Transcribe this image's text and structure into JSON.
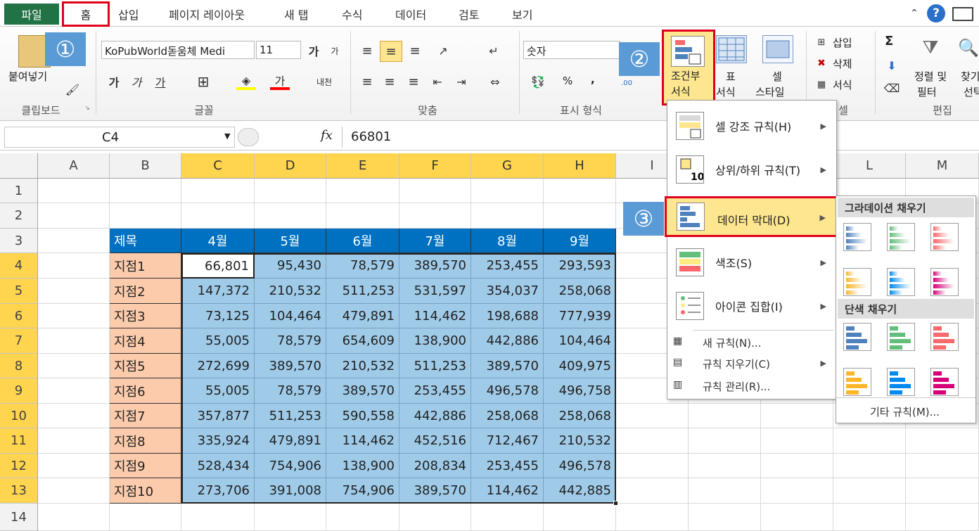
{
  "tabs": {
    "file": "파일",
    "home": "홈",
    "insert": "삽입",
    "layout": "페이지 레이아웃",
    "newtab": "새 탭",
    "formulas": "수식",
    "data": "데이터",
    "review": "검토",
    "view": "보기"
  },
  "ribbon": {
    "paste": "붙여넣기",
    "font_name": "KoPubWorld돋움체 Medi",
    "font_size": "11",
    "number_format": "숫자",
    "percent": "%",
    "comma": ",",
    "conditional_format_line1": "조건부",
    "conditional_format_line2": "서식",
    "table_format_line1": "표",
    "table_format_line2": "서식",
    "cell_style_line1": "셀",
    "cell_style_line2": "스타일",
    "insert": "삽입",
    "delete": "삭제",
    "format": "서식",
    "sigma": "Σ",
    "sort_line1": "정렬 및",
    "sort_line2": "필터",
    "find_line1": "찾기",
    "find_line2": "선택",
    "groups": {
      "clipboard": "클립보드",
      "font": "글꼴",
      "align": "맞춤",
      "number": "표시 형식",
      "cells": "셀",
      "edit": "편집"
    }
  },
  "badges": {
    "b1": "①",
    "b2": "②",
    "b3": "③"
  },
  "formula_bar": {
    "name_box": "C4",
    "fx": "fx",
    "value": "66801"
  },
  "columns": [
    "A",
    "B",
    "C",
    "D",
    "E",
    "F",
    "G",
    "H",
    "I",
    "J",
    "K",
    "L",
    "M"
  ],
  "rows": [
    "1",
    "2",
    "3",
    "4",
    "5",
    "6",
    "7",
    "8",
    "9",
    "10",
    "11",
    "12",
    "13",
    "14"
  ],
  "table": {
    "header": [
      "제목",
      "4월",
      "5월",
      "6월",
      "7월",
      "8월",
      "9월"
    ],
    "data": [
      [
        "지점1",
        "66,801",
        "95,430",
        "78,579",
        "389,570",
        "253,455",
        "293,593"
      ],
      [
        "지점2",
        "147,372",
        "210,532",
        "511,253",
        "531,597",
        "354,037",
        "258,068"
      ],
      [
        "지점3",
        "73,125",
        "104,464",
        "479,891",
        "114,462",
        "198,688",
        "777,939"
      ],
      [
        "지점4",
        "55,005",
        "78,579",
        "654,609",
        "138,900",
        "442,886",
        "104,464"
      ],
      [
        "지점5",
        "272,699",
        "389,570",
        "210,532",
        "511,253",
        "389,570",
        "409,975"
      ],
      [
        "지점6",
        "55,005",
        "78,579",
        "389,570",
        "253,455",
        "496,578",
        "496,758"
      ],
      [
        "지점7",
        "357,877",
        "511,253",
        "590,558",
        "442,886",
        "258,068",
        "258,068"
      ],
      [
        "지점8",
        "335,924",
        "479,891",
        "114,462",
        "452,516",
        "712,467",
        "210,532"
      ],
      [
        "지점9",
        "528,434",
        "754,906",
        "138,900",
        "208,834",
        "253,455",
        "496,578"
      ],
      [
        "지점10",
        "273,706",
        "391,008",
        "754,906",
        "389,570",
        "114,462",
        "442,885"
      ]
    ]
  },
  "cf_menu": {
    "highlight": "셀 강조 규칙(H)",
    "topbottom": "상위/하위 규칙(T)",
    "databar": "데이터 막대(D)",
    "colorscale": "색조(S)",
    "iconset": "아이콘 집합(I)",
    "newrule": "새 규칙(N)...",
    "clearrule": "규칙 지우기(C)",
    "managerule": "규칙 관리(R)..."
  },
  "db_menu": {
    "gradient": "그라데이션 채우기",
    "solid": "단색 채우기",
    "more": "기타 규칙(M)..."
  },
  "colors": {
    "blue": "#4f81bd",
    "green": "#63be7b",
    "red": "#f8696b",
    "orange": "#ffb628",
    "lightblue": "#008aef",
    "purple": "#d6007b"
  }
}
